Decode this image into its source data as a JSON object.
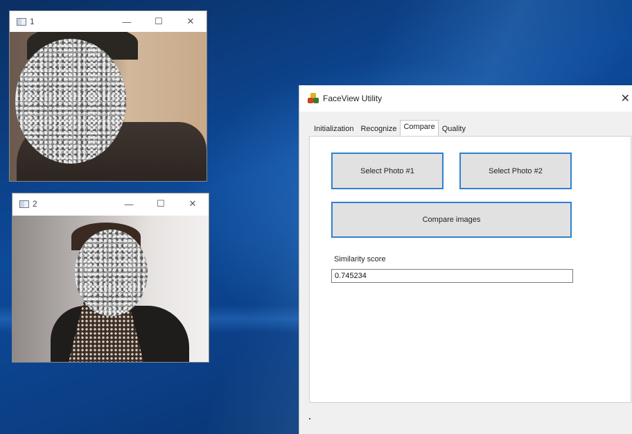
{
  "desktop": {
    "window1": {
      "title": "1",
      "minimize": "—",
      "maximize": "☐",
      "close": "✕"
    },
    "window2": {
      "title": "2",
      "minimize": "—",
      "maximize": "☐",
      "close": "✕"
    }
  },
  "app": {
    "title": "FaceView Utility",
    "close": "✕",
    "tabs": [
      {
        "label": "Initialization"
      },
      {
        "label": "Recognize"
      },
      {
        "label": "Compare",
        "active": true
      },
      {
        "label": "Quality"
      }
    ],
    "compare": {
      "select_photo_1": "Select Photo #1",
      "select_photo_2": "Select Photo #2",
      "compare_button": "Compare images",
      "similarity_label": "Similarity score",
      "similarity_value": "0.745234"
    }
  },
  "colors": {
    "accent_border": "#2f7fd1",
    "desktop_bg": "#0d4a9a"
  },
  "icons": [
    "window-app-icon",
    "minimize-icon",
    "maximize-icon",
    "close-icon",
    "faceview-app-icon"
  ]
}
